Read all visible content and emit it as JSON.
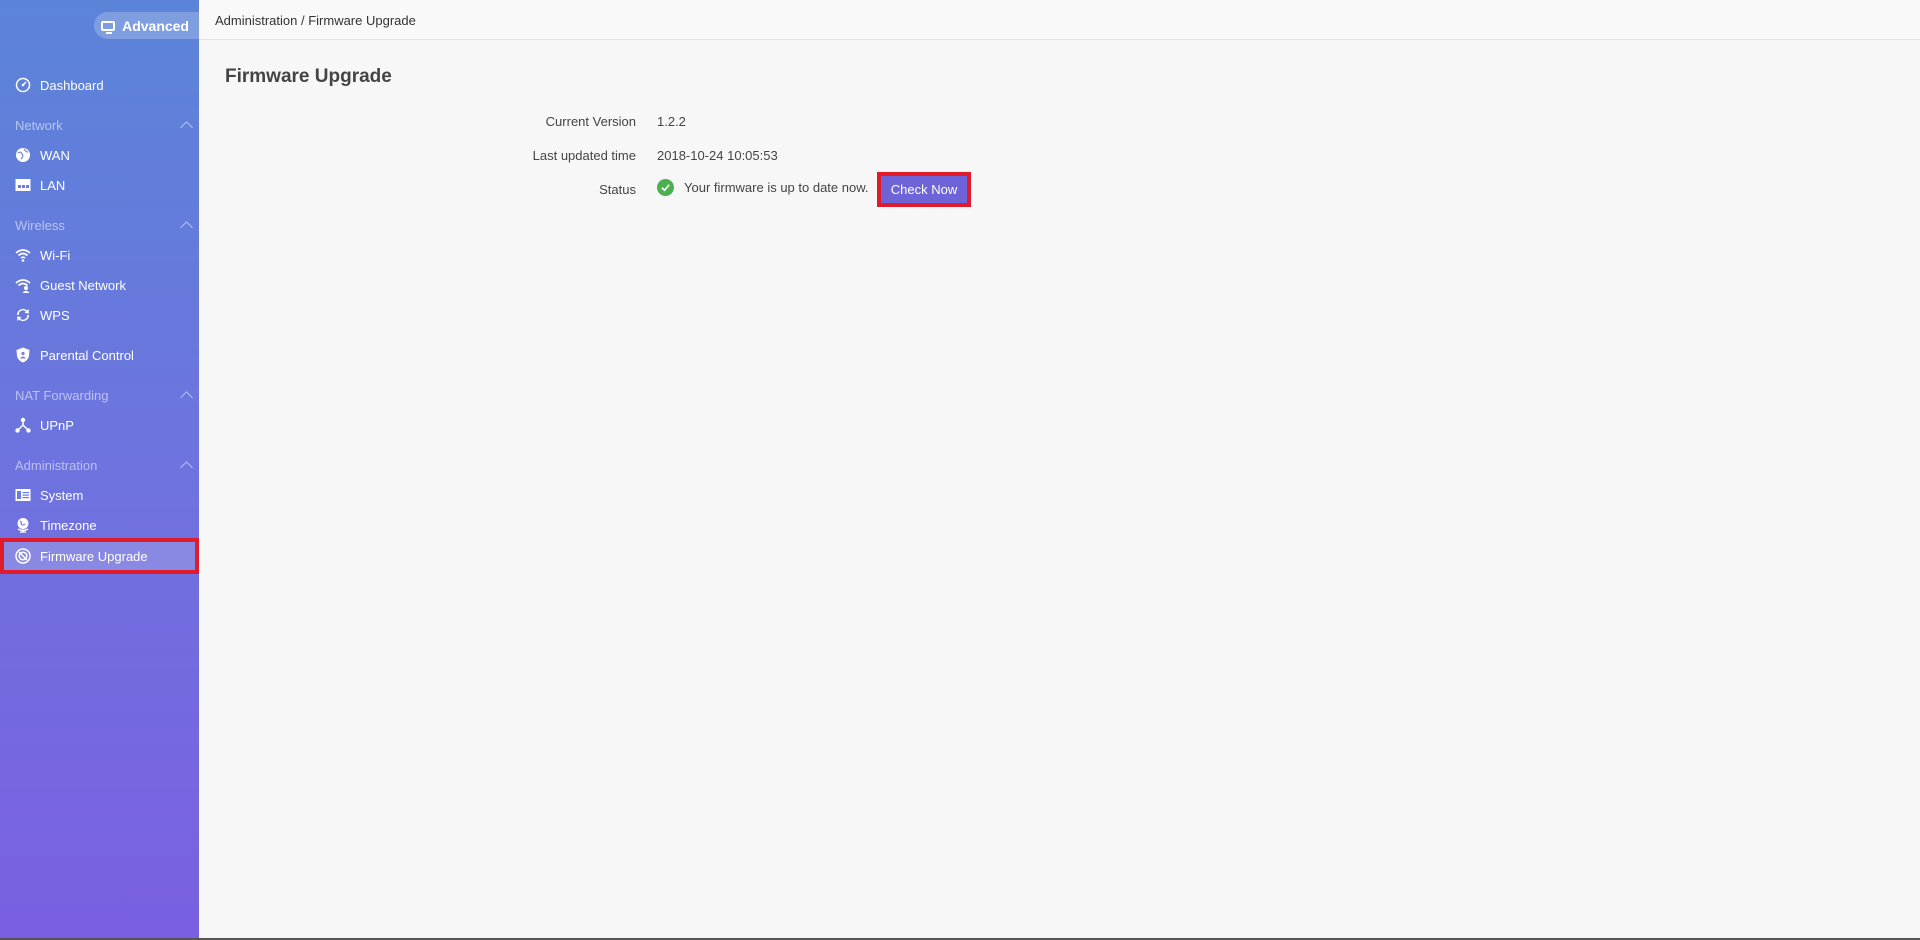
{
  "mode_toggle": {
    "label": "Advanced",
    "icon": "monitor-icon"
  },
  "breadcrumb": "Administration / Firmware Upgrade",
  "page_title": "Firmware Upgrade",
  "sidebar": {
    "dashboard": {
      "label": "Dashboard",
      "icon": "dashboard-icon"
    },
    "sections": {
      "network": "Network",
      "wireless": "Wireless",
      "nat": "NAT Forwarding",
      "administration": "Administration"
    },
    "items": {
      "wan": {
        "label": "WAN",
        "icon": "globe-icon"
      },
      "lan": {
        "label": "LAN",
        "icon": "lan-icon"
      },
      "wifi": {
        "label": "Wi-Fi",
        "icon": "wifi-icon"
      },
      "guest": {
        "label": "Guest Network",
        "icon": "guest-wifi-icon"
      },
      "wps": {
        "label": "WPS",
        "icon": "wps-icon"
      },
      "parental": {
        "label": "Parental Control",
        "icon": "shield-icon"
      },
      "upnp": {
        "label": "UPnP",
        "icon": "network-nodes-icon"
      },
      "system": {
        "label": "System",
        "icon": "system-icon"
      },
      "timezone": {
        "label": "Timezone",
        "icon": "globe-stand-icon"
      },
      "firmware": {
        "label": "Firmware Upgrade",
        "icon": "firmware-icon",
        "active": true
      }
    }
  },
  "firmware": {
    "current_version_label": "Current Version",
    "current_version": "1.2.2",
    "last_updated_label": "Last updated time",
    "last_updated": "2018-10-24 10:05:53",
    "status_label": "Status",
    "status_text": "Your firmware is up to date now.",
    "check_button": "Check Now"
  },
  "colors": {
    "sidebar_top": "#5b84d8",
    "sidebar_bottom": "#7a5fe0",
    "button": "#6e64d8",
    "status_ok": "#4caf50",
    "highlight": "#e01b2c"
  }
}
